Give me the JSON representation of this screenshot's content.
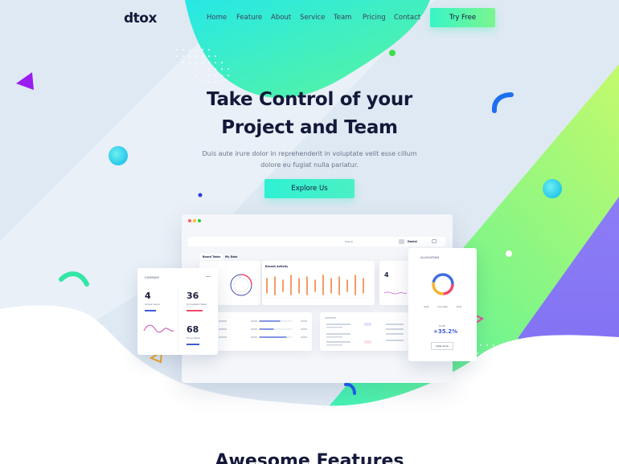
{
  "nav": {
    "logo": "dtox",
    "items": [
      "Home",
      "Feature",
      "About",
      "Service",
      "Team",
      "Pricing",
      "Contact"
    ],
    "cta": "Try Free"
  },
  "hero": {
    "title_line1": "Take Control of your",
    "title_line2": "Project and Team",
    "subtitle_line1": "Duis aute irure dolor in reprehenderit in voluptate velit esse cillum",
    "subtitle_line2": "dolore eu fugiat nulla pariatur.",
    "cta": "Explore Us"
  },
  "dashboard": {
    "tabs": [
      "Board Tasks",
      "My Data"
    ],
    "search_placeholder": "Search",
    "user": "Danial",
    "company_card": {
      "title": "COMPANY",
      "stats": [
        {
          "value": "4",
          "label": "Active Users"
        },
        {
          "value": "36",
          "label": "Completed Tasks"
        },
        {
          "value": "68",
          "label": "Done Tasks"
        }
      ]
    },
    "recent_activity_title": "Recent Activity",
    "allocation_card": {
      "title": "ALLOCATION",
      "legend": [
        "Safe",
        "Low Risk",
        "Risk"
      ],
      "profit_label": "Profit",
      "profit_value": "+35.2%",
      "button": "View more"
    },
    "side_value": "4"
  },
  "features_heading": "Awesome Features",
  "colors": {
    "accent_green": "#38f5c7",
    "accent_cyan": "#2ff0d4",
    "accent_purple": "#8a78f5",
    "dark": "#14193a"
  }
}
